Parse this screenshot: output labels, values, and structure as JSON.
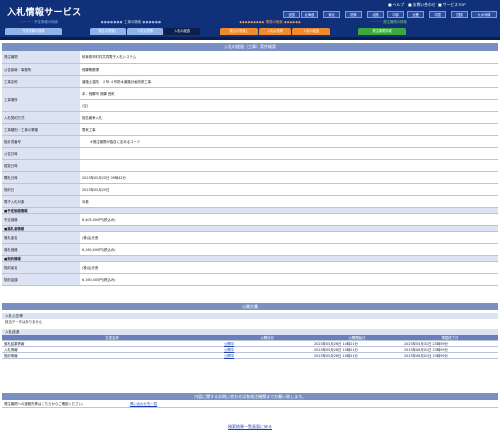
{
  "header": {
    "title": "入札情報サービス",
    "help": "ヘルプ",
    "contact": "お問い合わせ",
    "top": "サービスTOP",
    "regions": [
      "全国",
      "北海道",
      "東北",
      "関東",
      "北陸",
      "中部",
      "近畿",
      "中国",
      "四国",
      "九州沖縄"
    ],
    "groups": [
      {
        "label": "予定情報の検索"
      },
      {
        "label": "工事の検索"
      },
      {
        "label": "業務の検索"
      },
      {
        "label": "発注機関の検索"
      }
    ],
    "tabs": [
      "予定情報の検索",
      "発注の見通し",
      "入札公告等",
      "入札の経過",
      "発注の見通し",
      "入札公告等",
      "入札の経過",
      "発注機関情報"
    ]
  },
  "detail": {
    "heading": "入札の経過（工事）案件概要",
    "rows": [
      {
        "label": "発注機関",
        "value": "岐阜県市町村共同電子入札システム"
      },
      {
        "label": "公告部局・事務所",
        "value": "飛騨警察課"
      },
      {
        "label": "工事名称",
        "value": "道路土濃改　２号-４号防水道路計画改修工事"
      },
      {
        "label": "工事場所",
        "value": "本：飛騨市 飛騨 西町"
      },
      {
        "label": "",
        "value": "(空)"
      },
      {
        "label": "入札契約方式",
        "value": "指名競争入札"
      },
      {
        "label": "工事種別／工事の業種",
        "value": "電気工事"
      },
      {
        "label": "設計書番号",
        "value": "※発注機関が独自に定めるコード"
      },
      {
        "label": "公告日時",
        "value": ""
      },
      {
        "label": "縦覧日時",
        "value": ""
      },
      {
        "label": "開札日時",
        "value": "2023年05月25日 09時42分"
      },
      {
        "label": "契約日",
        "value": "2023年05月25日"
      },
      {
        "label": "電子入札対象",
        "value": "対象"
      }
    ],
    "price_head": "予定価格情報",
    "price_rows": [
      {
        "label": "予定価格",
        "value": "6,405,000円(税込み)"
      }
    ],
    "winner_head": "落札者情報",
    "winner_rows": [
      {
        "label": "落札者名",
        "value": "(株)弘光舎"
      },
      {
        "label": "落札価格",
        "value": "6,160,000円(税込み)"
      }
    ],
    "contract_head": "契約情報",
    "contract_rows": [
      {
        "label": "契約者名",
        "value": "(株)弘光舎"
      },
      {
        "label": "契約金額",
        "value": "6,160,000円(税込み)"
      }
    ]
  },
  "docs": {
    "heading": "公開文書",
    "notice_head": "入札公告等",
    "notice_none": "該当データはありません",
    "progress_head": "入札経過",
    "columns": [
      "文書名称",
      "公開状況",
      "公開開始日",
      "掲載終了日"
    ],
    "rows": [
      {
        "name": "落札結果情報",
        "status": "公開中",
        "start": "2023年05月26日 10時21分",
        "end": "2023年05月31日 23時59分"
      },
      {
        "name": "入札情報",
        "status": "公開中",
        "start": "2023年05月26日 10時21分",
        "end": "2023年06月01日 23時59分"
      },
      {
        "name": "契約情報",
        "status": "公開中",
        "start": "2023年05月26日 10時21分",
        "end": "2023年06月01日 23時59分"
      }
    ]
  },
  "inquiry": {
    "heading": "内容に関するお問い合わせは各発注機関までお願い致します。",
    "label": "発注機関への連絡先等はこちらからご確認ください。",
    "link": "問い合わせ先一覧"
  },
  "footer": {
    "back": "検索結果一覧画面に戻る"
  },
  "colors": {
    "header": "#10307a",
    "label_bg": "#dce3f3",
    "band": "#7a8fc2"
  }
}
